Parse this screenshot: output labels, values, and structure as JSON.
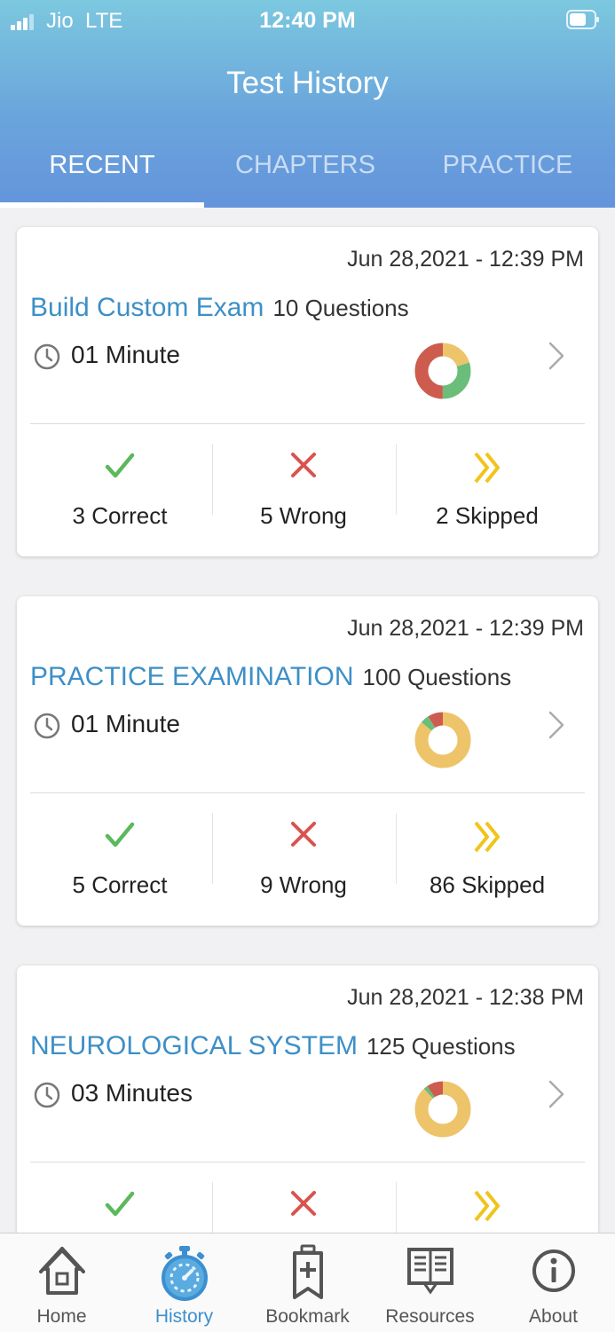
{
  "status_bar": {
    "carrier": "Jio",
    "network": "LTE",
    "time": "12:40 PM"
  },
  "header": {
    "title": "Test History"
  },
  "tabs": [
    {
      "label": "RECENT",
      "active": true
    },
    {
      "label": "CHAPTERS",
      "active": false
    },
    {
      "label": "PRACTICE",
      "active": false
    }
  ],
  "tests": [
    {
      "date": "Jun 28,2021 - 12:39 PM",
      "name": "Build Custom Exam",
      "questions": "10 Questions",
      "duration": "01 Minute",
      "correct_label": "3 Correct",
      "wrong_label": "5 Wrong",
      "skipped_label": "2 Skipped",
      "correct": 3,
      "wrong": 5,
      "skipped": 2
    },
    {
      "date": "Jun 28,2021 - 12:39 PM",
      "name": "PRACTICE EXAMINATION",
      "questions": "100 Questions",
      "duration": "01 Minute",
      "correct_label": "5 Correct",
      "wrong_label": "9 Wrong",
      "skipped_label": "86 Skipped",
      "correct": 5,
      "wrong": 9,
      "skipped": 86
    },
    {
      "date": "Jun 28,2021 - 12:38 PM",
      "name": "NEUROLOGICAL SYSTEM",
      "questions": "125 Questions",
      "duration": "03 Minutes",
      "correct_label": "",
      "wrong_label": "",
      "skipped_label": "",
      "correct": 3,
      "wrong": 12,
      "skipped": 110
    }
  ],
  "colors": {
    "correct": "#5cb85c",
    "wrong": "#d9534f",
    "skipped": "#f0c419",
    "donut_correct": "#6bbd7a",
    "donut_wrong": "#cd5c4e",
    "donut_skipped": "#eec46a",
    "accent": "#3d8fc7"
  },
  "bottom_nav": [
    {
      "label": "Home",
      "icon": "home-icon",
      "active": false
    },
    {
      "label": "History",
      "icon": "stopwatch-icon",
      "active": true
    },
    {
      "label": "Bookmark",
      "icon": "bookmark-icon",
      "active": false
    },
    {
      "label": "Resources",
      "icon": "book-icon",
      "active": false
    },
    {
      "label": "About",
      "icon": "info-icon",
      "active": false
    }
  ]
}
